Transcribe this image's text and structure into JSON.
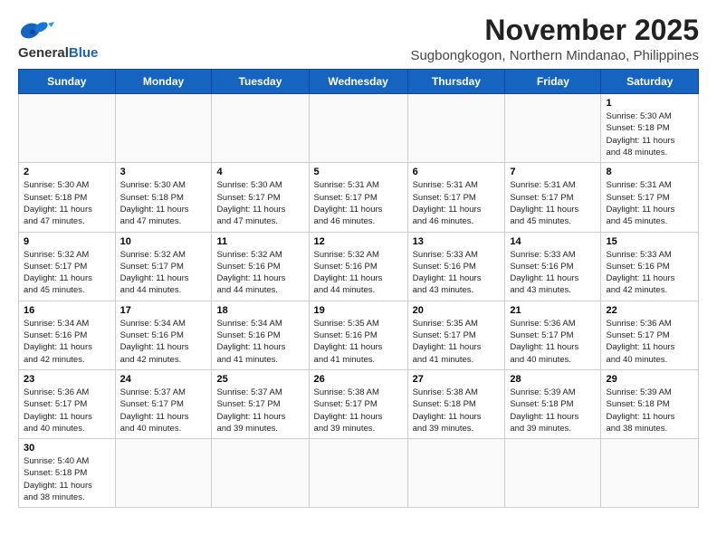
{
  "header": {
    "logo_line1": "General",
    "logo_line2": "Blue",
    "month_title": "November 2025",
    "location": "Sugbongkogon, Northern Mindanao, Philippines"
  },
  "weekdays": [
    "Sunday",
    "Monday",
    "Tuesday",
    "Wednesday",
    "Thursday",
    "Friday",
    "Saturday"
  ],
  "weeks": [
    [
      {
        "day": "",
        "info": ""
      },
      {
        "day": "",
        "info": ""
      },
      {
        "day": "",
        "info": ""
      },
      {
        "day": "",
        "info": ""
      },
      {
        "day": "",
        "info": ""
      },
      {
        "day": "",
        "info": ""
      },
      {
        "day": "1",
        "info": "Sunrise: 5:30 AM\nSunset: 5:18 PM\nDaylight: 11 hours\nand 48 minutes."
      }
    ],
    [
      {
        "day": "2",
        "info": "Sunrise: 5:30 AM\nSunset: 5:18 PM\nDaylight: 11 hours\nand 47 minutes."
      },
      {
        "day": "3",
        "info": "Sunrise: 5:30 AM\nSunset: 5:18 PM\nDaylight: 11 hours\nand 47 minutes."
      },
      {
        "day": "4",
        "info": "Sunrise: 5:30 AM\nSunset: 5:17 PM\nDaylight: 11 hours\nand 47 minutes."
      },
      {
        "day": "5",
        "info": "Sunrise: 5:31 AM\nSunset: 5:17 PM\nDaylight: 11 hours\nand 46 minutes."
      },
      {
        "day": "6",
        "info": "Sunrise: 5:31 AM\nSunset: 5:17 PM\nDaylight: 11 hours\nand 46 minutes."
      },
      {
        "day": "7",
        "info": "Sunrise: 5:31 AM\nSunset: 5:17 PM\nDaylight: 11 hours\nand 45 minutes."
      },
      {
        "day": "8",
        "info": "Sunrise: 5:31 AM\nSunset: 5:17 PM\nDaylight: 11 hours\nand 45 minutes."
      }
    ],
    [
      {
        "day": "9",
        "info": "Sunrise: 5:32 AM\nSunset: 5:17 PM\nDaylight: 11 hours\nand 45 minutes."
      },
      {
        "day": "10",
        "info": "Sunrise: 5:32 AM\nSunset: 5:17 PM\nDaylight: 11 hours\nand 44 minutes."
      },
      {
        "day": "11",
        "info": "Sunrise: 5:32 AM\nSunset: 5:16 PM\nDaylight: 11 hours\nand 44 minutes."
      },
      {
        "day": "12",
        "info": "Sunrise: 5:32 AM\nSunset: 5:16 PM\nDaylight: 11 hours\nand 44 minutes."
      },
      {
        "day": "13",
        "info": "Sunrise: 5:33 AM\nSunset: 5:16 PM\nDaylight: 11 hours\nand 43 minutes."
      },
      {
        "day": "14",
        "info": "Sunrise: 5:33 AM\nSunset: 5:16 PM\nDaylight: 11 hours\nand 43 minutes."
      },
      {
        "day": "15",
        "info": "Sunrise: 5:33 AM\nSunset: 5:16 PM\nDaylight: 11 hours\nand 42 minutes."
      }
    ],
    [
      {
        "day": "16",
        "info": "Sunrise: 5:34 AM\nSunset: 5:16 PM\nDaylight: 11 hours\nand 42 minutes."
      },
      {
        "day": "17",
        "info": "Sunrise: 5:34 AM\nSunset: 5:16 PM\nDaylight: 11 hours\nand 42 minutes."
      },
      {
        "day": "18",
        "info": "Sunrise: 5:34 AM\nSunset: 5:16 PM\nDaylight: 11 hours\nand 41 minutes."
      },
      {
        "day": "19",
        "info": "Sunrise: 5:35 AM\nSunset: 5:16 PM\nDaylight: 11 hours\nand 41 minutes."
      },
      {
        "day": "20",
        "info": "Sunrise: 5:35 AM\nSunset: 5:17 PM\nDaylight: 11 hours\nand 41 minutes."
      },
      {
        "day": "21",
        "info": "Sunrise: 5:36 AM\nSunset: 5:17 PM\nDaylight: 11 hours\nand 40 minutes."
      },
      {
        "day": "22",
        "info": "Sunrise: 5:36 AM\nSunset: 5:17 PM\nDaylight: 11 hours\nand 40 minutes."
      }
    ],
    [
      {
        "day": "23",
        "info": "Sunrise: 5:36 AM\nSunset: 5:17 PM\nDaylight: 11 hours\nand 40 minutes."
      },
      {
        "day": "24",
        "info": "Sunrise: 5:37 AM\nSunset: 5:17 PM\nDaylight: 11 hours\nand 40 minutes."
      },
      {
        "day": "25",
        "info": "Sunrise: 5:37 AM\nSunset: 5:17 PM\nDaylight: 11 hours\nand 39 minutes."
      },
      {
        "day": "26",
        "info": "Sunrise: 5:38 AM\nSunset: 5:17 PM\nDaylight: 11 hours\nand 39 minutes."
      },
      {
        "day": "27",
        "info": "Sunrise: 5:38 AM\nSunset: 5:18 PM\nDaylight: 11 hours\nand 39 minutes."
      },
      {
        "day": "28",
        "info": "Sunrise: 5:39 AM\nSunset: 5:18 PM\nDaylight: 11 hours\nand 39 minutes."
      },
      {
        "day": "29",
        "info": "Sunrise: 5:39 AM\nSunset: 5:18 PM\nDaylight: 11 hours\nand 38 minutes."
      }
    ],
    [
      {
        "day": "30",
        "info": "Sunrise: 5:40 AM\nSunset: 5:18 PM\nDaylight: 11 hours\nand 38 minutes."
      },
      {
        "day": "",
        "info": ""
      },
      {
        "day": "",
        "info": ""
      },
      {
        "day": "",
        "info": ""
      },
      {
        "day": "",
        "info": ""
      },
      {
        "day": "",
        "info": ""
      },
      {
        "day": "",
        "info": ""
      }
    ]
  ]
}
